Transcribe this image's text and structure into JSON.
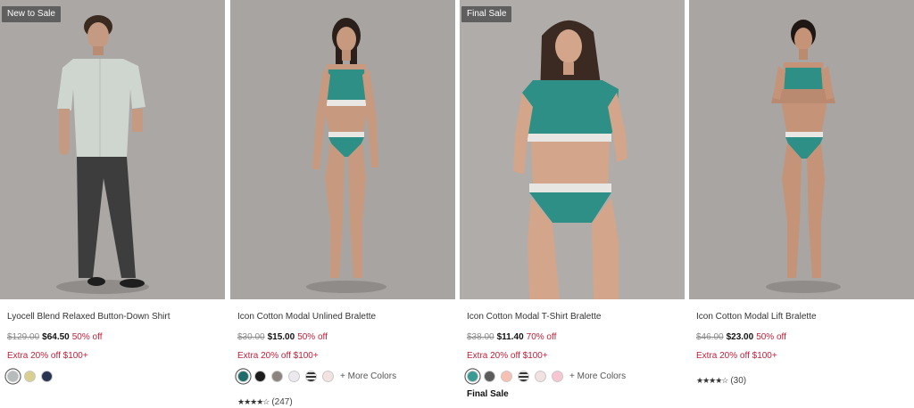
{
  "products": [
    {
      "badge": "New to Sale",
      "title": "Lyocell Blend Relaxed Button-Down Shirt",
      "price_original": "$129.00",
      "price_sale": "$64.50",
      "discount": "50% off",
      "promo": "Extra 20% off $100+",
      "swatches": [
        "#b7bbbb",
        "#d9cf8f",
        "#2a3552"
      ]
    },
    {
      "title": "Icon Cotton Modal Unlined Bralette",
      "price_original": "$30.00",
      "price_sale": "$15.00",
      "discount": "50% off",
      "promo": "Extra 20% off $100+",
      "swatches": [
        "#1f6c6a",
        "#1d1d1d",
        "#8d8480",
        "#ebe8ee",
        "stripe",
        "#f3e2e2"
      ],
      "more_colors": "+ More Colors",
      "stars": "★★★★☆",
      "rating_count": "(247)"
    },
    {
      "badge": "Final Sale",
      "title": "Icon Cotton Modal T-Shirt Bralette",
      "price_original": "$38.00",
      "price_sale": "$11.40",
      "discount": "70% off",
      "promo": "Extra 20% off $100+",
      "swatches": [
        "#3a9a94",
        "#5b5b5b",
        "#f6c1b2",
        "stripe",
        "#f1e1e1",
        "#f7c6d2"
      ],
      "more_colors": "+ More Colors",
      "final_sale": "Final Sale"
    },
    {
      "title": "Icon Cotton Modal Lift Bralette",
      "price_original": "$46.00",
      "price_sale": "$23.00",
      "discount": "50% off",
      "promo": "Extra 20% off $100+",
      "stars": "★★★★☆",
      "rating_count": "(30)"
    }
  ],
  "colors": {
    "discount_red": "#c2203a",
    "badge_bg": "#5f5f5f",
    "photo_bg": "#a9a6a3",
    "teal": "#2e8f86"
  }
}
